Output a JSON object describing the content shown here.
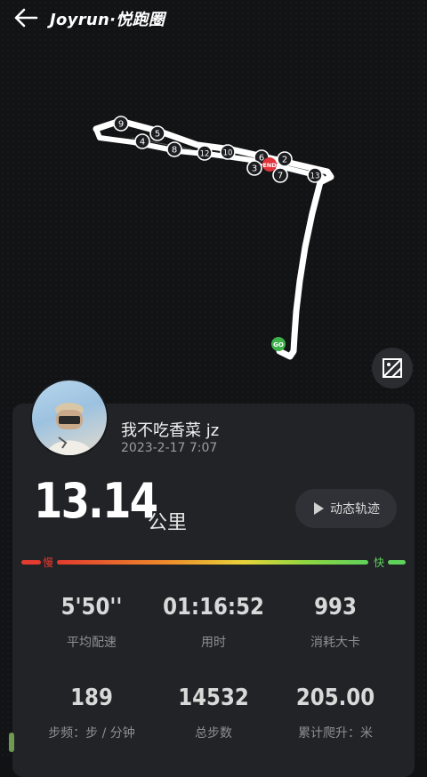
{
  "header": {
    "brand": "Joyrun·悦跑圈",
    "back_icon": "arrow-left-icon"
  },
  "map": {
    "start_label": "GO",
    "end_label": "END",
    "km_markers": [
      "9",
      "5",
      "4",
      "8",
      "12",
      "10",
      "6",
      "2",
      "3",
      "7",
      "13"
    ],
    "toggle_icon": "image-icon"
  },
  "profile": {
    "name": "我不吃香菜 jz",
    "datetime": "2023-2-17 7:07"
  },
  "summary": {
    "distance": "13.14",
    "unit": "公里",
    "replay_label": "动态轨迹",
    "slow_label": "慢",
    "fast_label": "快"
  },
  "stats": [
    {
      "value": "5'50''",
      "label": "平均配速"
    },
    {
      "value": "01:16:52",
      "label": "用时"
    },
    {
      "value": "993",
      "label": "消耗大卡"
    },
    {
      "value": "189",
      "label": "步频：步 / 分钟"
    },
    {
      "value": "14532",
      "label": "总步数"
    },
    {
      "value": "205.00",
      "label": "累计爬升：米"
    }
  ],
  "colors": {
    "background": "#111214",
    "card": "#212327",
    "route": "#ffffff",
    "start": "#3db14a",
    "end": "#e2323a",
    "slow": "#e23b2f",
    "fast": "#5fd25b"
  }
}
